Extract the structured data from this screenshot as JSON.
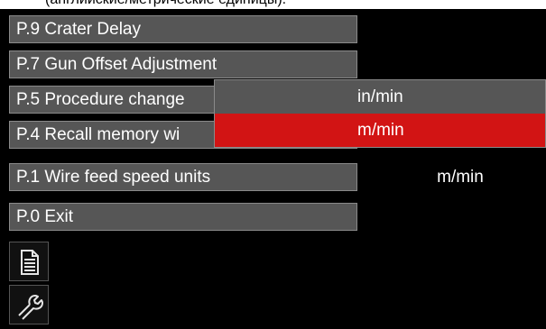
{
  "caption": {
    "text": "(английские/метрические единицы)."
  },
  "menu": {
    "items": [
      {
        "label": "P.9 Crater Delay"
      },
      {
        "label": "P.7 Gun Offset Adjustment"
      },
      {
        "label": "P.5 Procedure change"
      },
      {
        "label": "P.4 Recall memory wi"
      },
      {
        "label": "P.1 Wire feed speed units",
        "value": "m/min"
      },
      {
        "label": "P.0 Exit"
      }
    ]
  },
  "popup": {
    "options": [
      {
        "label": "in/min",
        "selected": false
      },
      {
        "label": "m/min",
        "selected": true
      }
    ],
    "selected_color": "#d21414"
  },
  "sidebar_icons": [
    {
      "icon": "document-icon"
    },
    {
      "icon": "wrench-icon"
    }
  ],
  "colors": {
    "background": "#000000",
    "menu_item": "#565656",
    "menu_border": "#8a8a8a",
    "text": "#ffffff",
    "highlight": "#d21414"
  }
}
